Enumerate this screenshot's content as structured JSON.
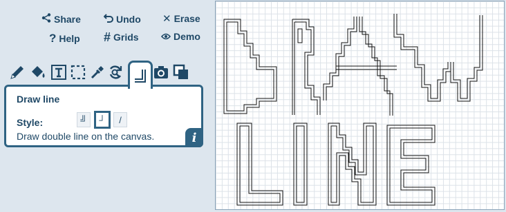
{
  "toolbar_top": {
    "share": "Share",
    "undo": "Undo",
    "erase": "Erase",
    "help": "Help",
    "grids": "Grids",
    "demo": "Demo"
  },
  "tools": [
    "pencil-icon",
    "paint-bucket-icon",
    "text-icon",
    "select-icon",
    "eyedropper-icon",
    "replace-icon",
    "draw-line-icon",
    "camera-icon",
    "layers-icon"
  ],
  "active_tool": "draw-line",
  "panel": {
    "title": "Draw line",
    "style_label": "Style:",
    "style_options": [
      "╝",
      "┘",
      "/"
    ],
    "selected_style": 1,
    "description": "Draw double line on the canvas.",
    "info": "i"
  },
  "colors": {
    "accent": "#2f6383",
    "text": "#1f4866",
    "background": "#dde6ee",
    "grid": "#dce2e8",
    "line": "#111111"
  }
}
